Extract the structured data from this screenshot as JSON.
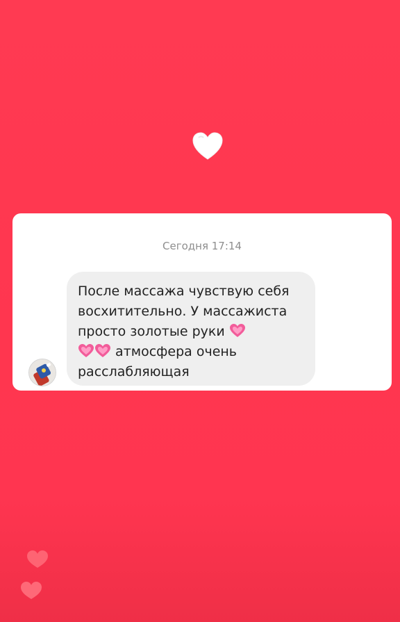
{
  "story": {
    "background_color": "#ff3a52",
    "top_icon": "white-heart-icon"
  },
  "message_card": {
    "timestamp": "Сегодня 17:14",
    "avatar": "sender-avatar",
    "message": {
      "line1": "После массажа чувствую себя",
      "line2": "восхитительно. У массажиста",
      "line3": "просто золотые руки",
      "line4_text": "атмосфера очень",
      "line5": "расслабляющая",
      "emoji": "growing-heart-icon"
    }
  },
  "reactions": {
    "icon": "floating-heart-icon"
  }
}
